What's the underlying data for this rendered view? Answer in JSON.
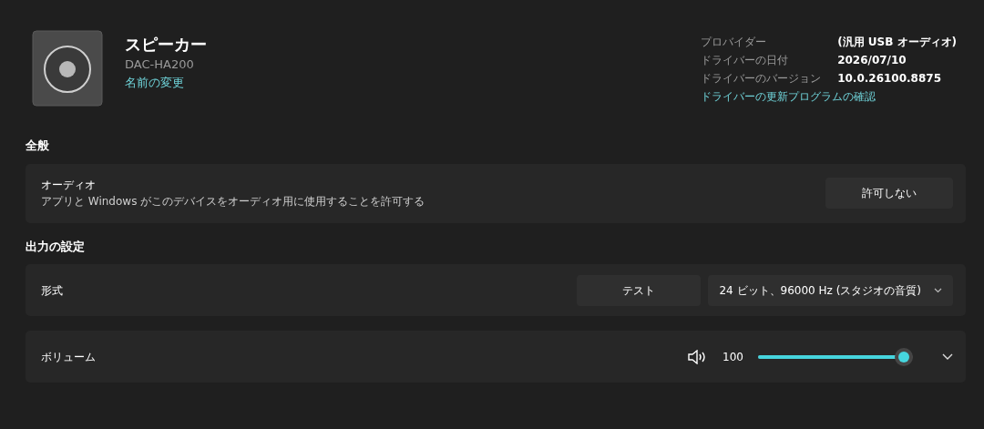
{
  "device": {
    "title": "スピーカー",
    "model": "DAC-HA200",
    "rename_link": "名前の変更"
  },
  "driver_info": [
    {
      "label": "プロバイダー",
      "value": "(汎用 USB オーディオ)"
    },
    {
      "label": "ドライバーの日付",
      "value": "2026/07/10"
    },
    {
      "label": "ドライバーのバージョン",
      "value": "10.0.26100.8875"
    }
  ],
  "driver_update_link": "ドライバーの更新プログラムの確認",
  "sections": [
    {
      "heading": "全般",
      "rows": [
        {
          "kind": "button",
          "title": "オーディオ",
          "description": "アプリと Windows がこのデバイスをオーディオ用に使用することを許可する",
          "button": "許可しない"
        }
      ]
    },
    {
      "heading": "出力の設定",
      "rows": [
        {
          "kind": "format",
          "title": "形式",
          "button": "テスト",
          "dropdown": "24 ビット、96000 Hz (スタジオの音質)"
        },
        {
          "kind": "volume",
          "title": "ボリューム",
          "reading": "100",
          "level": 1.0
        }
      ]
    }
  ]
}
